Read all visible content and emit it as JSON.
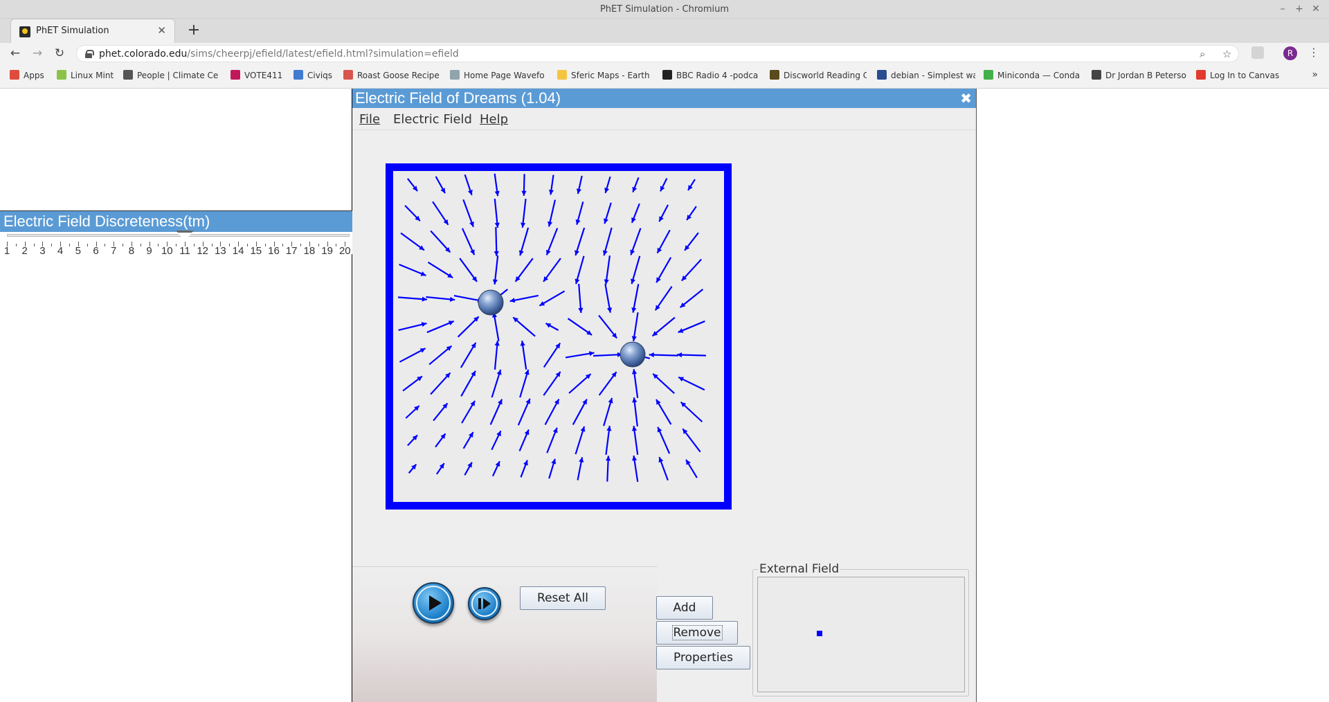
{
  "window": {
    "title": "PhET Simulation - Chromium"
  },
  "tab": {
    "label": "PhET Simulation"
  },
  "toolbar": {
    "url_host": "phet.colorado.edu",
    "url_path": "/sims/cheerpj/efield/latest/efield.html?simulation=efield",
    "profile_letter": "R"
  },
  "bookmarks": [
    {
      "label": "Apps",
      "color": "#e04b3c"
    },
    {
      "label": "Linux Mint",
      "color": "#8bc34a"
    },
    {
      "label": "People | Climate Ce",
      "color": "#555555"
    },
    {
      "label": "VOTE411",
      "color": "#c2185b"
    },
    {
      "label": "Civiqs",
      "color": "#3f7bd1"
    },
    {
      "label": "Roast Goose Recipe",
      "color": "#d9534f"
    },
    {
      "label": "Home Page Wavefo",
      "color": "#90a4ae"
    },
    {
      "label": "Sferic Maps - Earth",
      "color": "#f5c542"
    },
    {
      "label": "BBC Radio 4 -podca",
      "color": "#222222"
    },
    {
      "label": "Discworld Reading C",
      "color": "#5b4a1c"
    },
    {
      "label": "debian - Simplest wa",
      "color": "#2a4d8f"
    },
    {
      "label": "Miniconda — Conda",
      "color": "#43b049"
    },
    {
      "label": "Dr Jordan B Peterso",
      "color": "#444444"
    },
    {
      "label": "Log In to Canvas",
      "color": "#e23b2e"
    }
  ],
  "discreteness": {
    "title": "Electric Field Discreteness(tm)",
    "ticks": [
      "1",
      "2",
      "3",
      "4",
      "5",
      "6",
      "7",
      "8",
      "9",
      "10",
      "11",
      "12",
      "13",
      "14",
      "15",
      "16",
      "17",
      "18",
      "19",
      "20"
    ],
    "value": 11
  },
  "app": {
    "title": "Electric Field of Dreams (1.04)",
    "menu": {
      "file": "File",
      "efield": "Electric Field",
      "help": "Help"
    },
    "buttons": {
      "reset": "Reset All",
      "add": "Add",
      "remove": "Remove",
      "properties": "Properties"
    },
    "external_field": {
      "label": "External Field"
    },
    "colors": {
      "field": "#0000ff",
      "header": "#5b9bd5"
    }
  }
}
